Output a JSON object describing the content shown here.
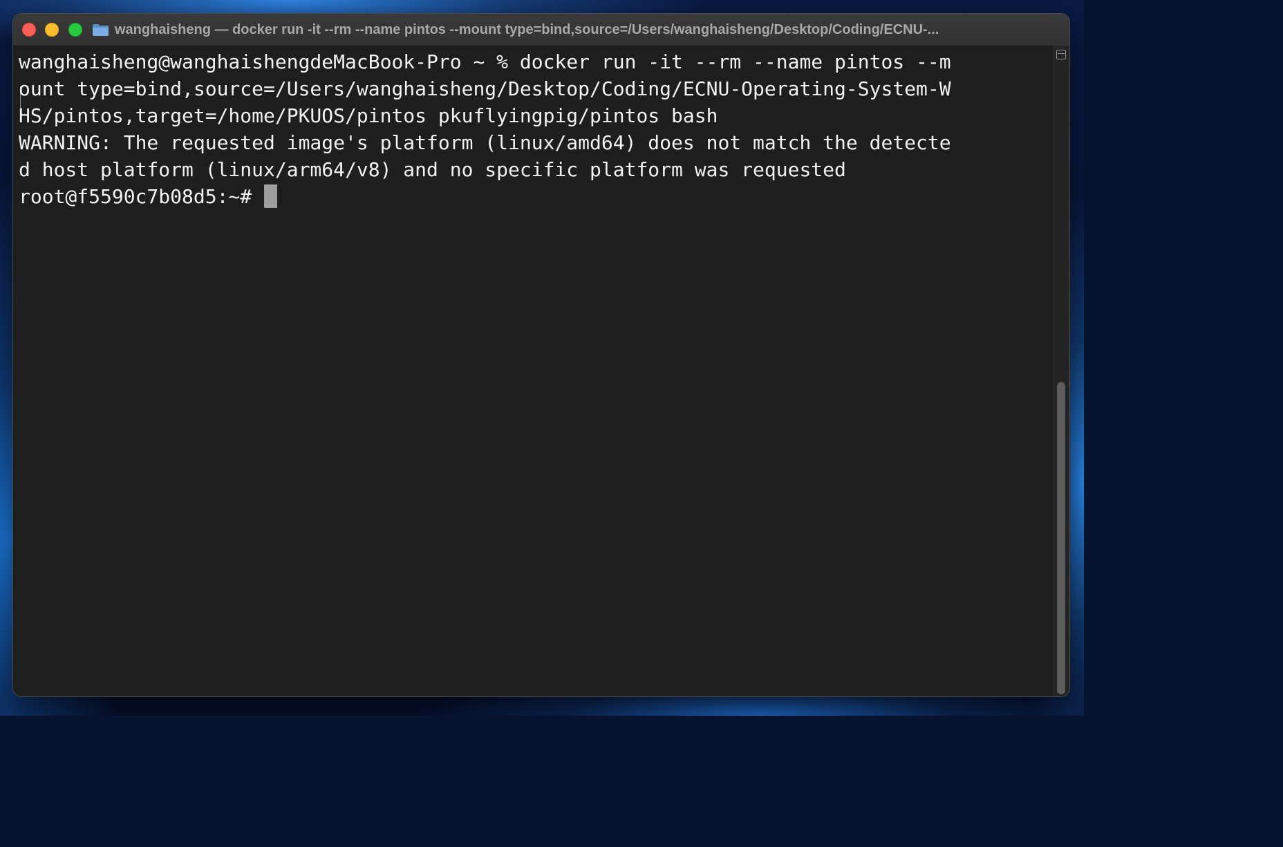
{
  "window": {
    "title": "wanghaisheng — docker run -it --rm --name pintos --mount type=bind,source=/Users/wanghaisheng/Desktop/Coding/ECNU-..."
  },
  "icons": {
    "folder": "folder-icon",
    "close": "close-icon",
    "minimize": "minimize-icon",
    "zoom": "zoom-icon",
    "split": "split-pane-icon"
  },
  "colors": {
    "terminal_background": "#1e1e1e",
    "terminal_foreground": "#f2f2f2",
    "close": "#fe5f57",
    "minimize": "#febc2e",
    "zoom": "#28c840",
    "cursor": "#9d9d9d"
  },
  "terminal": {
    "lines": [
      "wanghaisheng@wanghaishengdeMacBook-Pro ~ % docker run -it --rm --name pintos --m",
      "ount type=bind,source=/Users/wanghaisheng/Desktop/Coding/ECNU-Operating-System-W",
      "HS/pintos,target=/home/PKUOS/pintos pkuflyingpig/pintos bash",
      "WARNING: The requested image's platform (linux/amd64) does not match the detecte",
      "d host platform (linux/arm64/v8) and no specific platform was requested"
    ],
    "prompt": "root@f5590c7b08d5:~#"
  }
}
